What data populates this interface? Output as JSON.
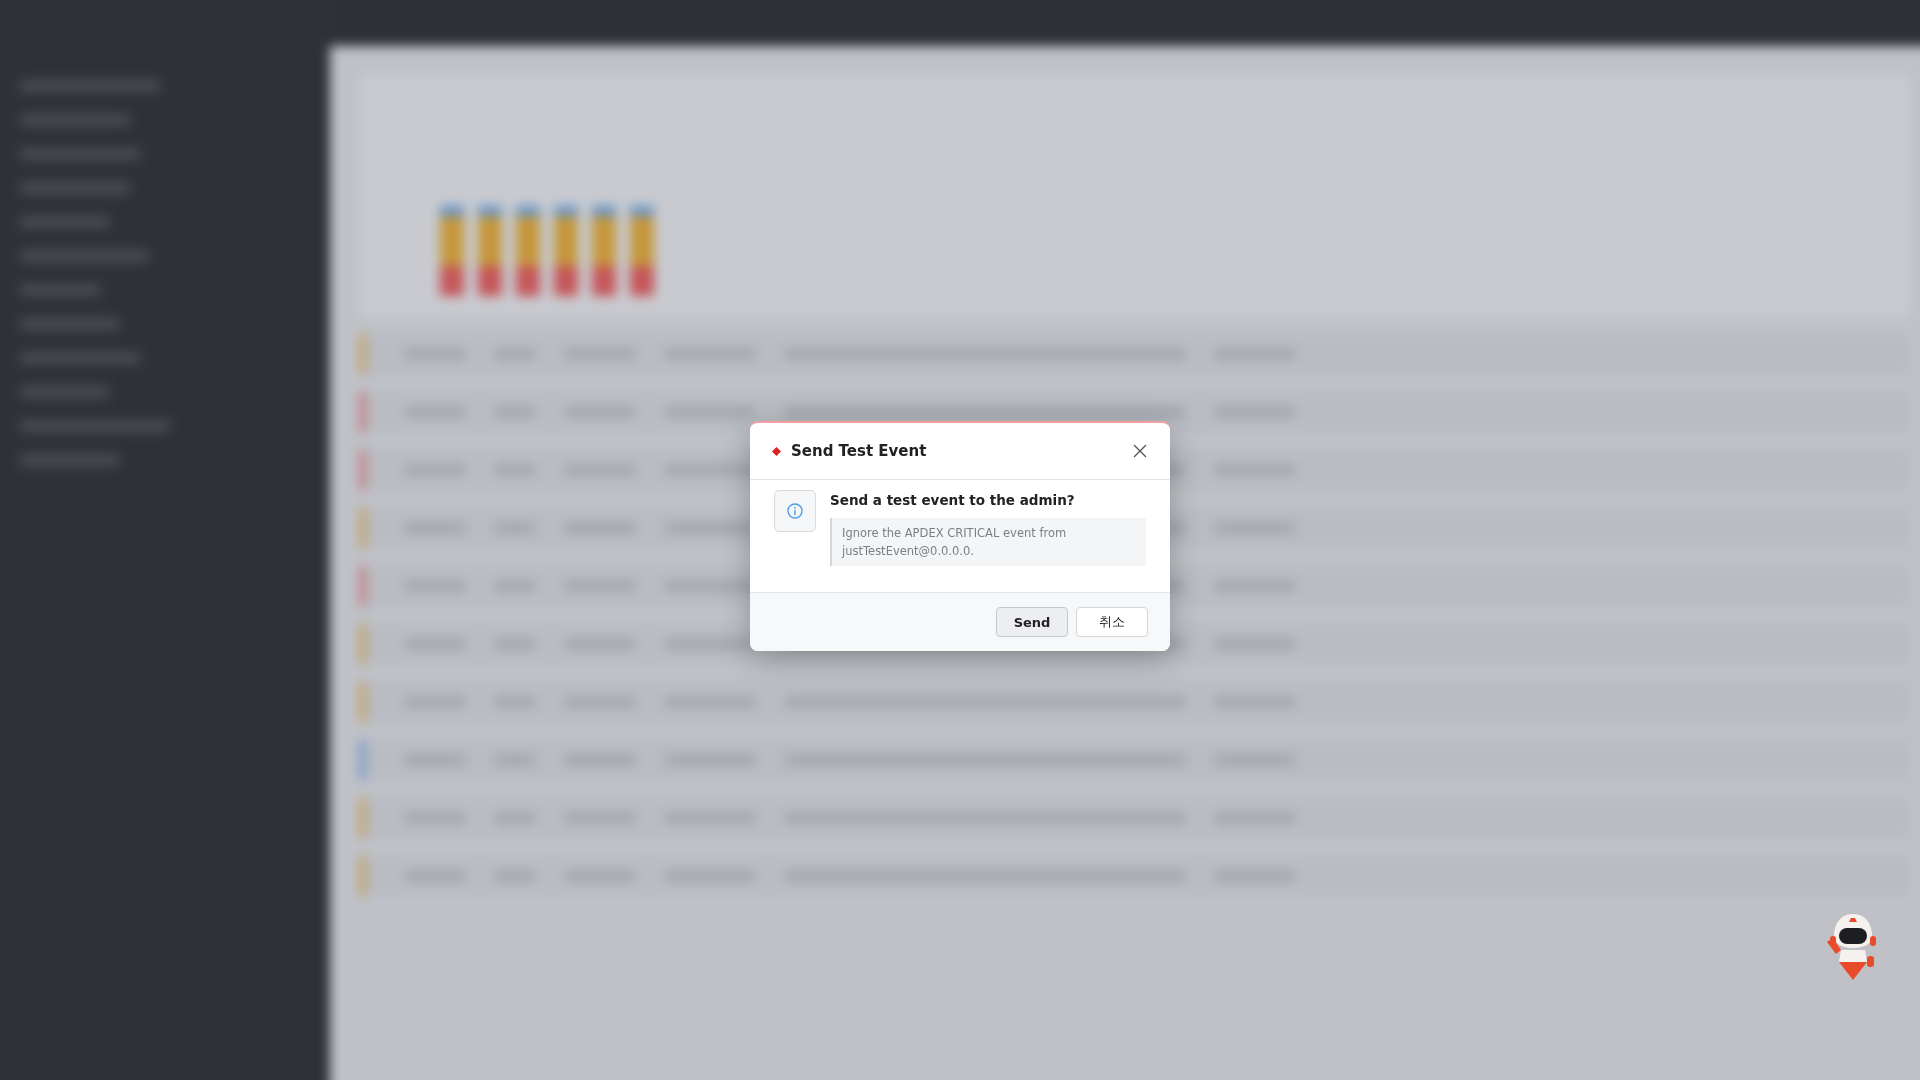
{
  "dialog": {
    "title": "Send Test Event",
    "question": "Send a test event to the admin?",
    "message": "Ignore the APDEX CRITICAL event from justTestEvent@0.0.0.0.",
    "buttons": [
      {
        "label": "Send",
        "kind": "primary"
      },
      {
        "label": "취소",
        "kind": "cancel"
      }
    ]
  }
}
